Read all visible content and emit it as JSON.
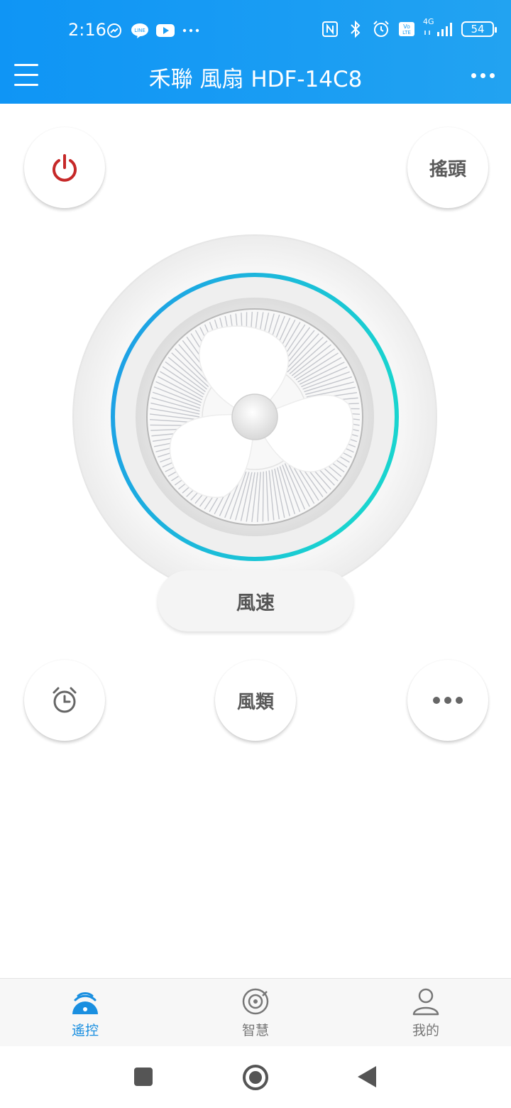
{
  "status_bar": {
    "time": "2:16",
    "battery": "54",
    "network": "4G",
    "icons": [
      "speed-icon",
      "line-icon",
      "youtube-icon",
      "more-dots-icon",
      "nfc-icon",
      "bluetooth-icon",
      "alarm-icon",
      "volte-icon",
      "signal-icon"
    ]
  },
  "header": {
    "title": "禾聯 風扇 HDF-14C8",
    "menu_icon": "hamburger-icon",
    "more_icon": "more-horizontal-icon"
  },
  "controls": {
    "power_icon": "power-icon",
    "power_color": "#c62828",
    "oscillate_label": "搖頭",
    "speed_label": "風速",
    "timer_icon": "alarm-clock-icon",
    "mode_label": "風類",
    "more_icon": "more-horizontal-icon"
  },
  "fan": {
    "ring_gradient": [
      "#1e9be8",
      "#19d4cf"
    ]
  },
  "tabbar": {
    "tabs": [
      {
        "label": "遙控",
        "icon": "remote-icon",
        "active": true
      },
      {
        "label": "智慧",
        "icon": "smart-icon",
        "active": false
      },
      {
        "label": "我的",
        "icon": "profile-icon",
        "active": false
      }
    ],
    "active_color": "#1a8fe0",
    "inactive_color": "#777777"
  },
  "navbar": {
    "icons": [
      "recent-apps-icon",
      "home-icon",
      "back-icon"
    ]
  }
}
